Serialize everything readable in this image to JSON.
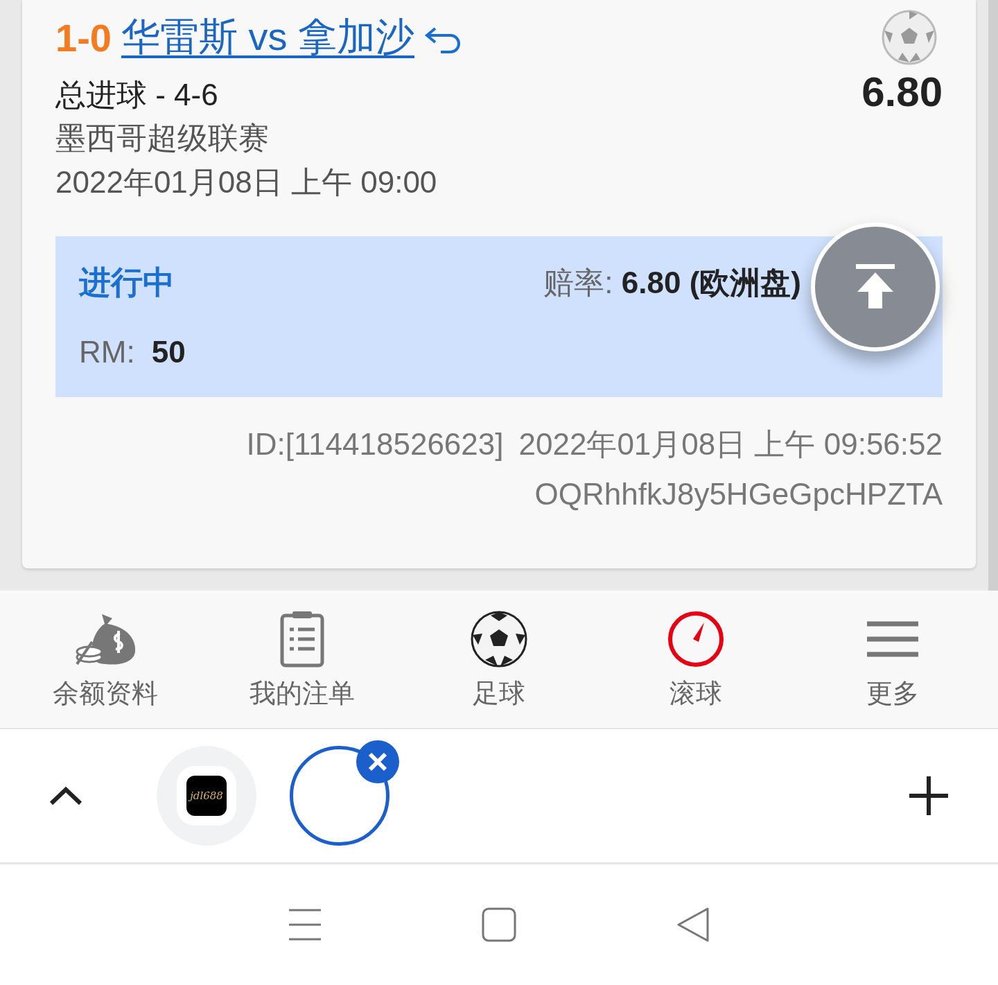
{
  "bet": {
    "score": "1-0",
    "match": "华雷斯 vs 拿加沙",
    "market": "总进球 - 4-6",
    "odds": "6.80",
    "league": "墨西哥超级联赛",
    "kickoff": "2022年01月08日 上午 09:00",
    "status": "进行中",
    "odds_label": "赔率:",
    "odds_value": "6.80 (欧洲盘)",
    "stake_label": "RM:",
    "stake": "50",
    "bet_id": "ID:[114418526623]",
    "placed_at": "2022年01月08日 上午 09:56:52",
    "code": "OQRhhfkJ8y5HGeGpcHPZTA"
  },
  "bottom_nav": [
    {
      "label": "余额资料",
      "kind": "money",
      "selected": false
    },
    {
      "label": "我的注单",
      "kind": "slip",
      "selected": false
    },
    {
      "label": "足球",
      "kind": "ball",
      "selected": false
    },
    {
      "label": "滚球",
      "kind": "gauge",
      "selected": true
    },
    {
      "label": "更多",
      "kind": "menu",
      "selected": false
    }
  ],
  "browser_tabs": [
    {
      "kind": "site",
      "logo": "jdl688",
      "selected": false
    },
    {
      "kind": "blank",
      "selected": true
    }
  ]
}
